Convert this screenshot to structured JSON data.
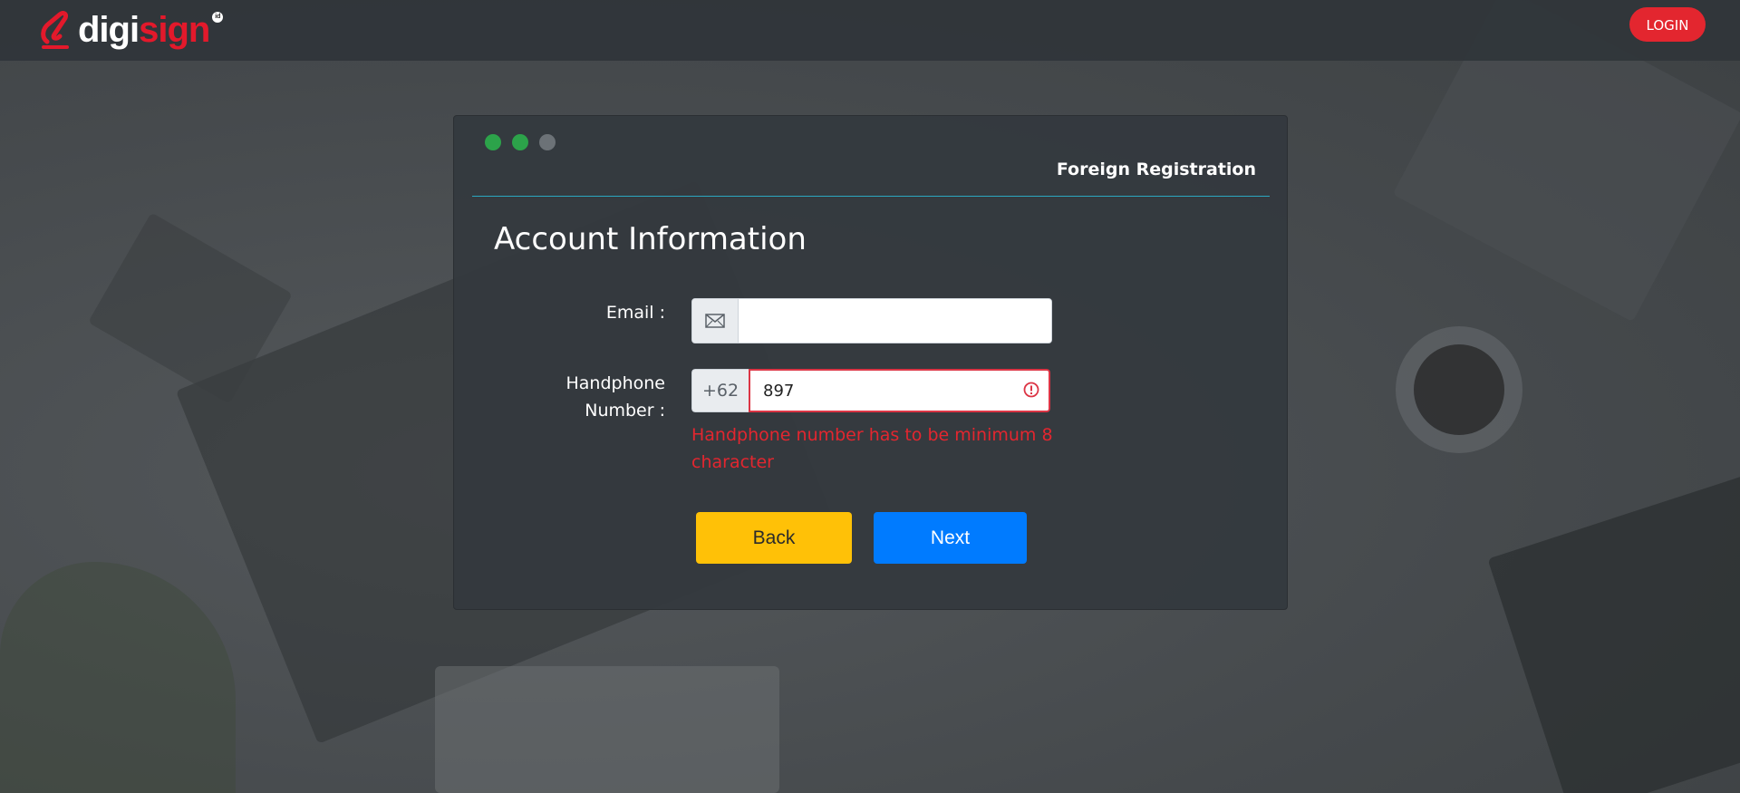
{
  "header": {
    "logo_digi": "digi",
    "logo_sign": "sign",
    "logo_reg": "id",
    "login_label": "LOGIN"
  },
  "card": {
    "title": "Foreign Registration",
    "section_title": "Account Information",
    "window_dots": [
      "green",
      "green",
      "gray"
    ]
  },
  "form": {
    "email_label": "Email :",
    "email_value": "",
    "email_icon": "envelope-icon",
    "phone_label": "Handphone Number :",
    "phone_code": "+62",
    "phone_value": "897",
    "phone_error": "Handphone number has to be minimum 8 character",
    "error_icon": "exclamation-circle-icon"
  },
  "buttons": {
    "back_label": "Back",
    "next_label": "Next"
  },
  "colors": {
    "accent_red": "#e3262f",
    "back_yellow": "#ffc107",
    "next_blue": "#007bff",
    "dot_green": "#2ca34a",
    "rule_teal": "#2aa7c1"
  }
}
